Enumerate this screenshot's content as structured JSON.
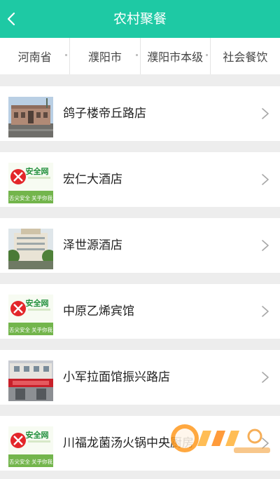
{
  "header": {
    "title": "农村聚餐",
    "back_icon": "chevron-left-icon"
  },
  "filters": [
    {
      "label": "河南省"
    },
    {
      "label": "濮阳市"
    },
    {
      "label": "濮阳市本级"
    },
    {
      "label": "社会餐饮"
    }
  ],
  "list": {
    "items": [
      {
        "name": "鸽子楼帝丘路店",
        "thumb": "building-photo"
      },
      {
        "name": "宏仁大酒店",
        "thumb": "food-safety-logo"
      },
      {
        "name": "泽世源酒店",
        "thumb": "hotel-photo"
      },
      {
        "name": "中原乙烯宾馆",
        "thumb": "food-safety-logo"
      },
      {
        "name": "小军拉面馆振兴路店",
        "thumb": "noodle-shop-photo"
      },
      {
        "name": "川福龙菌汤火锅中央厨房",
        "thumb": "food-safety-logo"
      }
    ],
    "logo_text": {
      "main": "安全网",
      "left": "舌尖安全",
      "right": "关乎你我"
    }
  },
  "colors": {
    "accent": "#1ec9a4",
    "page_bg": "#ededed"
  }
}
